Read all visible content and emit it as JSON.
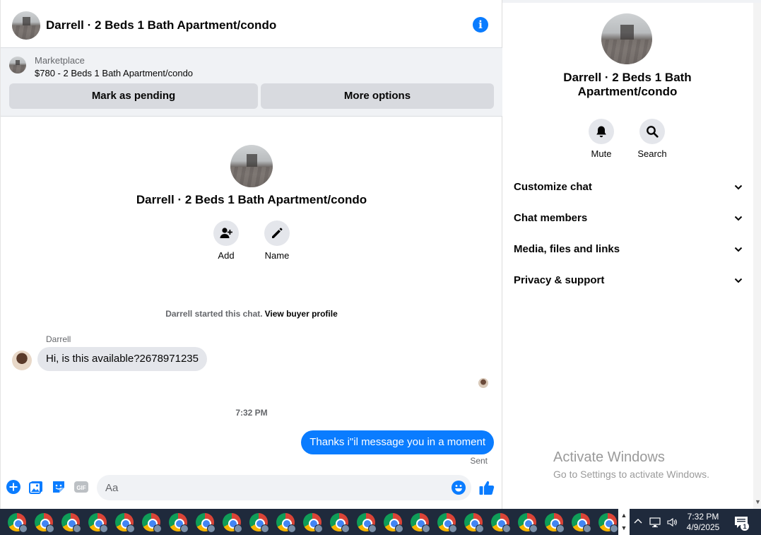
{
  "colors": {
    "messenger_blue": "#0a7cff",
    "bubble_gray": "#e4e6eb",
    "panel_gray": "#f0f2f5",
    "taskbar": "#1f2a3c"
  },
  "chat": {
    "title": "Darrell · 2 Beds 1 Bath Apartment/condo",
    "info_icon": "info-icon",
    "marketplace": {
      "label": "Marketplace",
      "listing": "$780 - 2 Beds 1 Bath Apartment/condo",
      "mark_pending_label": "Mark as pending",
      "more_options_label": "More options"
    },
    "intro": {
      "title": "Darrell · 2 Beds 1 Bath Apartment/condo",
      "actions": [
        {
          "label": "Add",
          "icon": "add-person-icon"
        },
        {
          "label": "Name",
          "icon": "pencil-icon"
        }
      ]
    },
    "system_message": {
      "text": "Darrell started this chat.",
      "link": "View buyer profile"
    },
    "messages": [
      {
        "sender": "Darrell",
        "text": "Hi, is this available?2678971235",
        "direction": "incoming"
      },
      {
        "timestamp": "7:32 PM"
      },
      {
        "text": "Thanks i\"il message you in a moment",
        "direction": "outgoing",
        "status": "Sent"
      }
    ],
    "composer": {
      "placeholder": "Aa",
      "icons": [
        "plus-icon",
        "photo-icon",
        "sticker-icon",
        "gif-icon",
        "emoji-icon",
        "thumbs-up-icon"
      ],
      "gif_label": "GIF"
    }
  },
  "panel": {
    "title": "Darrell · 2 Beds 1 Bath Apartment/condo",
    "actions": [
      {
        "label": "Mute",
        "icon": "bell-icon"
      },
      {
        "label": "Search",
        "icon": "search-icon"
      }
    ],
    "sections": [
      "Customize chat",
      "Chat members",
      "Media, files and links",
      "Privacy & support"
    ],
    "watermark": {
      "line1": "Activate Windows",
      "line2": "Go to Settings to activate Windows."
    }
  },
  "taskbar": {
    "app_count": 23,
    "app_icon": "chrome-profile-icon",
    "time": "7:32 PM",
    "date": "4/9/2025",
    "notification_count": "1",
    "tray_icons": [
      "chevron-up-icon",
      "network-icon",
      "volume-icon"
    ]
  }
}
